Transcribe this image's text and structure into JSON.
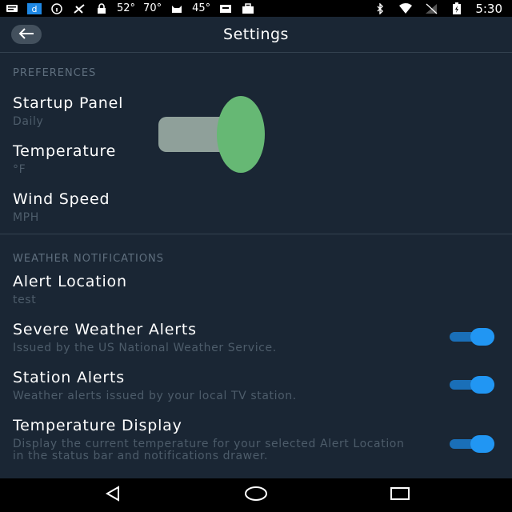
{
  "status_bar": {
    "temps": [
      "52°",
      "70°",
      "45°"
    ],
    "time": "5:30"
  },
  "toolbar": {
    "title": "Settings",
    "back_icon": "arrow-left-icon"
  },
  "preferences": {
    "header": "PREFERENCES",
    "items": [
      {
        "title": "Startup Panel",
        "value": "Daily"
      },
      {
        "title": "Temperature",
        "value": "°F"
      },
      {
        "title": "Wind Speed",
        "value": "MPH"
      }
    ]
  },
  "notifications": {
    "header": "WEATHER NOTIFICATIONS",
    "items": [
      {
        "title": "Alert Location",
        "value": "test"
      },
      {
        "title": "Severe Weather Alerts",
        "value": "Issued by the US National Weather Service.",
        "enabled": true
      },
      {
        "title": "Station Alerts",
        "value": "Weather alerts issued by your local TV station.",
        "enabled": true
      },
      {
        "title": "Temperature Display",
        "value": "Display the current temperature for your selected Alert Location in the status bar and notifications drawer.",
        "enabled": true
      }
    ]
  },
  "colors": {
    "background": "#1a2634",
    "accent": "#2196f3",
    "overlay_green": "#66b874"
  }
}
